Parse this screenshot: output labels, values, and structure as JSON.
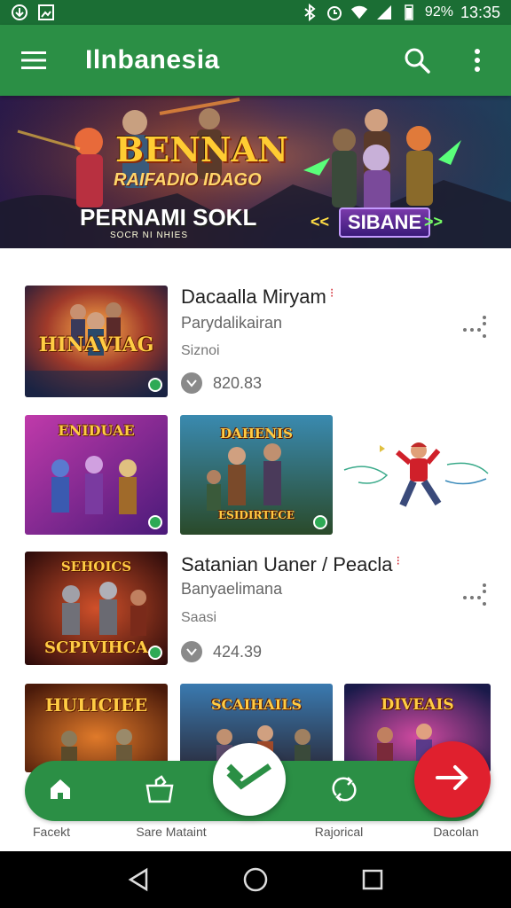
{
  "status_bar": {
    "battery": "92%",
    "time": "13:35",
    "icons": [
      "download-icon",
      "image-icon",
      "bluetooth-icon",
      "alarm-icon",
      "wifi-icon",
      "signal-icon",
      "battery-icon"
    ]
  },
  "app_bar": {
    "title": "Ilnbanesia",
    "icons": [
      "menu-icon",
      "search-icon",
      "more-vert-icon"
    ]
  },
  "banner": {
    "title": "BENNAN",
    "subtitle": "RAIFADIO IDAGO",
    "tag_left": "PERNAMI SOKL",
    "tag_left_sub": "SOCR NI NHIES",
    "tag_right": "SIBANE",
    "arrow_left": "<<",
    "arrow_right": ">>"
  },
  "items": [
    {
      "thumb_label": "HINAVIAG",
      "title": "Dacaalla Miryam",
      "subtitle": "Parydalikairan",
      "small": "Siznoi",
      "price": "820.83"
    },
    {
      "thumb_label": "SCPIVIHCA",
      "thumb_top": "SEHOICS",
      "title": "Satanian Uaner / Peacla",
      "subtitle": "Banyaelimana",
      "small": "Saasi",
      "price": "424.39"
    }
  ],
  "grid_row1": [
    {
      "label": "ENIDUAE"
    },
    {
      "label": "DAHENIS",
      "bottom": "ESIDIRTECE"
    }
  ],
  "grid_row2": [
    {
      "label": "HULICIEE"
    },
    {
      "label": "SCAIHAILS"
    },
    {
      "label": "DIVEAIS"
    }
  ],
  "bottom_nav": {
    "items": [
      {
        "label": "Facekt",
        "icon": "home-icon"
      },
      {
        "label": "Sare Mataint",
        "icon": "bag-icon"
      },
      {
        "label": "",
        "icon": "check-icon"
      },
      {
        "label": "Rajorical",
        "icon": "refresh-icon"
      },
      {
        "label": "Dacolan",
        "icon": "arrow-right-icon"
      }
    ]
  },
  "colors": {
    "primary": "#2b8f45",
    "status": "#1b6e34",
    "accent_red": "#e0202e"
  }
}
